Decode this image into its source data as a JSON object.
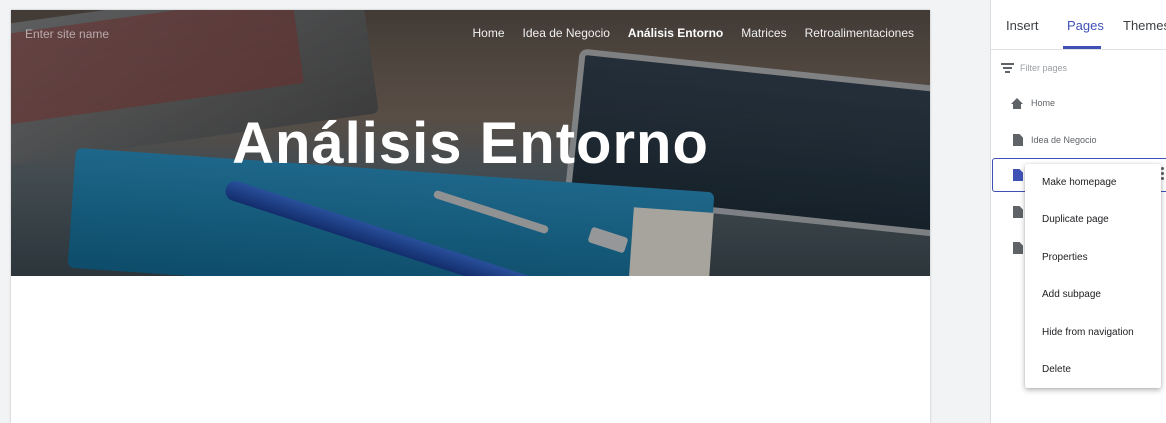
{
  "site": {
    "name_placeholder": "Enter site name",
    "nav": [
      "Home",
      "Idea de Negocio",
      "Análisis Entorno",
      "Matrices",
      "Retroalimentaciones"
    ],
    "active_nav": "Análisis Entorno",
    "hero_title": "Análisis Entorno"
  },
  "panel": {
    "tabs": [
      "Insert",
      "Pages",
      "Themes"
    ],
    "active_tab": "Pages",
    "filter_placeholder": "Filter pages",
    "pages": [
      {
        "label": "Home",
        "icon": "home-icon"
      },
      {
        "label": "Idea de Negocio",
        "icon": "page-icon"
      },
      {
        "label": "",
        "icon": "page-icon",
        "selected": true
      },
      {
        "label": "",
        "icon": "page-icon"
      },
      {
        "label": "",
        "icon": "page-icon"
      }
    ]
  },
  "context_menu": {
    "items": [
      "Make homepage",
      "Duplicate page",
      "Properties",
      "Add subpage",
      "Hide from navigation",
      "Delete"
    ]
  },
  "colors": {
    "accent": "#3f51b5",
    "canvas_bg": "#f1f3f4"
  }
}
